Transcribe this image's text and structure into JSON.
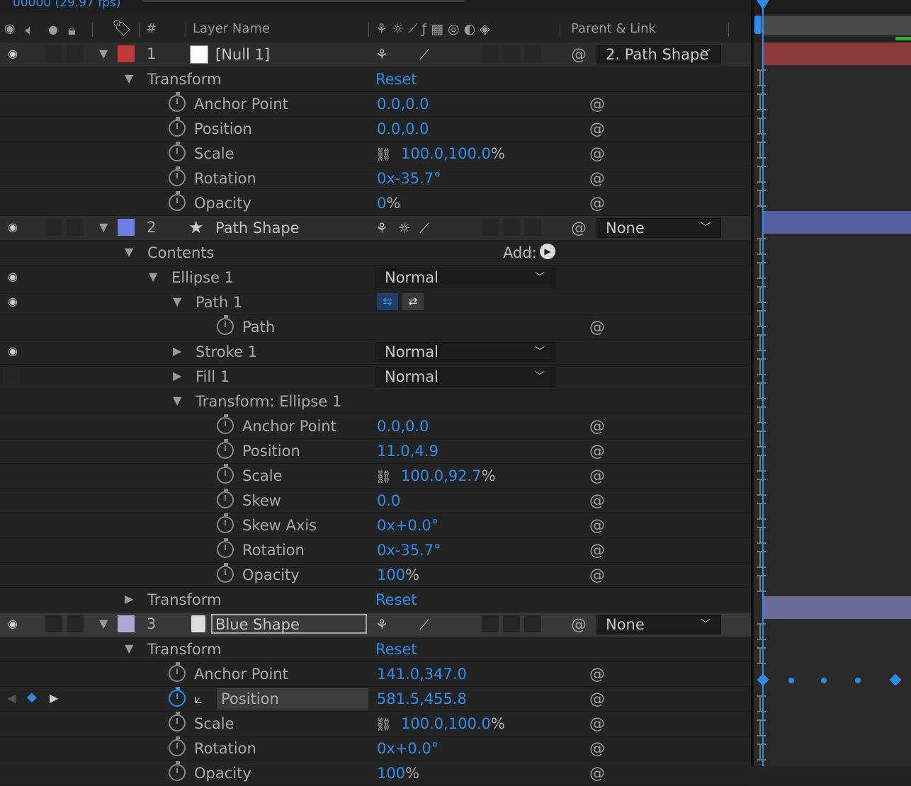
{
  "top": {
    "timecode": "00000 (29.97 fps)"
  },
  "header": {
    "layer_name": "Layer Name",
    "parent_link": "Parent & Link",
    "hash": "#"
  },
  "colors": {
    "accent": "#2d8ceb",
    "layer1": "#c33a3a",
    "layer2": "#6c7fe0",
    "layer3": "#a9a9d4",
    "bar1": "#8b3a3a",
    "bar2": "#5560a0",
    "bar3": "#6c6c9a"
  },
  "layer1": {
    "num": "1",
    "name": "[Null 1]",
    "parent": "2. Path Shape"
  },
  "layer2": {
    "num": "2",
    "name": "Path Shape",
    "parent": "None"
  },
  "layer3": {
    "num": "3",
    "name": "Blue Shape",
    "parent": "None"
  },
  "labels": {
    "transform": "Transform",
    "reset": "Reset",
    "anchor": "Anchor Point",
    "position": "Position",
    "scale": "Scale",
    "rotation": "Rotation",
    "opacity": "Opacity",
    "contents": "Contents",
    "add": "Add:",
    "ellipse1": "Ellipse 1",
    "path1": "Path 1",
    "path": "Path",
    "stroke1": "Stroke 1",
    "fill1": "Fill 1",
    "transform_ellipse": "Transform: Ellipse 1",
    "skew": "Skew",
    "skew_axis": "Skew Axis",
    "normal": "Normal"
  },
  "values": {
    "l1_anchor": "0.0,0.0",
    "l1_position": "0.0,0.0",
    "l1_scale": "100.0,100.0",
    "l1_rotation": "0x-35.7°",
    "l1_opacity": "0",
    "e_anchor": "0.0,0.0",
    "e_position": "11.0,4.9",
    "e_scale": "100.0,92.7",
    "e_skew": "0.0",
    "e_skew_axis": "0x+0.0°",
    "e_rotation": "0x-35.7°",
    "e_opacity": "100",
    "l3_anchor": "141.0,347.0",
    "l3_position": "581.5,455.8",
    "l3_scale": "100.0,100.0",
    "l3_rotation": "0x+0.0°",
    "l3_opacity": "100",
    "pct": "%"
  }
}
